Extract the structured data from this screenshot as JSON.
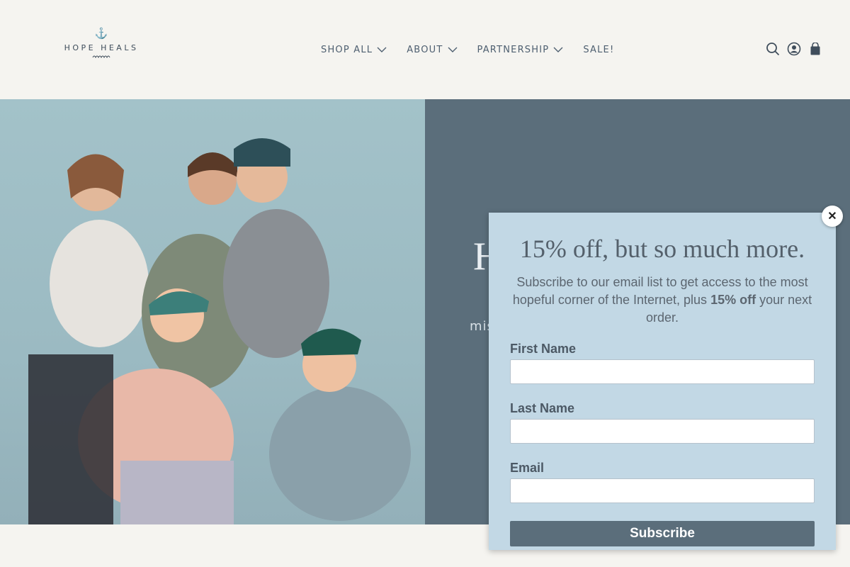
{
  "brand": {
    "name": "HOPE HEALS"
  },
  "nav": {
    "items": [
      {
        "label": "SHOP ALL"
      },
      {
        "label": "ABOUT"
      },
      {
        "label": "PARTNERSHIP"
      },
      {
        "label": "SALE!"
      }
    ]
  },
  "header_icons": [
    "search-icon",
    "account-icon",
    "cart-icon"
  ],
  "hero": {
    "title_partial": "H",
    "text_partial": "mis"
  },
  "popup": {
    "title": "15% off, but so much more.",
    "desc_pre": "Subscribe to our email list to get access to the most hopeful corner of the Internet, plus ",
    "desc_bold": "15% off",
    "desc_post": " your next order.",
    "fields": [
      {
        "label": "First Name",
        "value": ""
      },
      {
        "label": "Last Name",
        "value": ""
      },
      {
        "label": "Email",
        "value": ""
      }
    ],
    "submit_label": "Subscribe",
    "close_label": "✕"
  },
  "colors": {
    "accent": "#5b6e7b",
    "popup_bg": "#c2d8e5",
    "page_bg": "#f5f4f0"
  }
}
